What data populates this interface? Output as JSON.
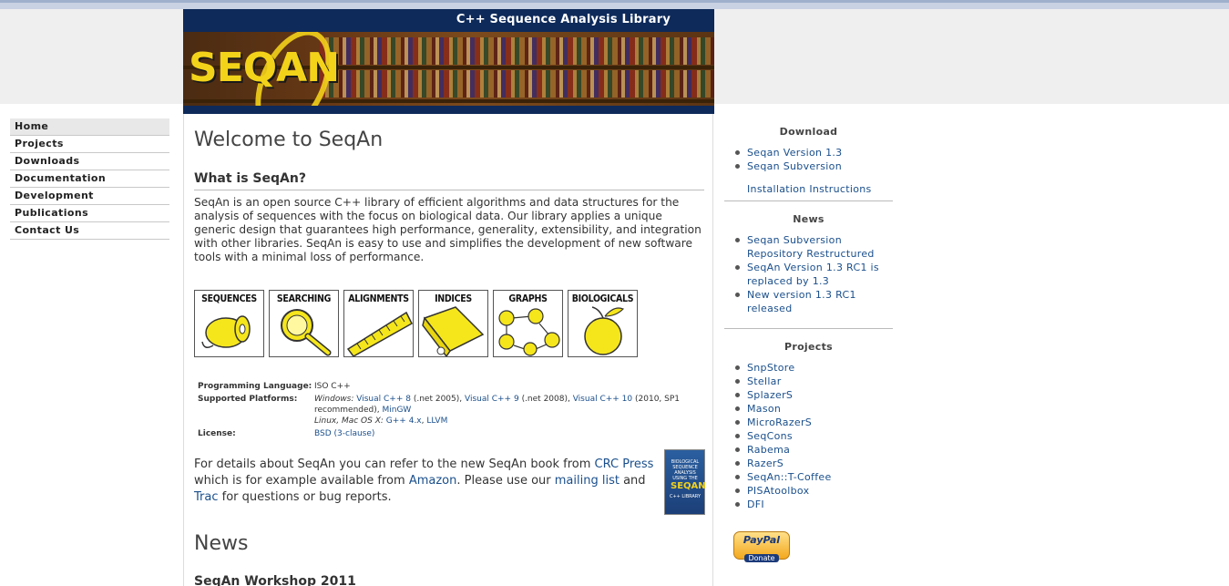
{
  "banner": {
    "subtitle": "C++ Sequence Analysis Library",
    "logo_text": "SEQAN"
  },
  "nav": {
    "items": [
      {
        "label": "Home"
      },
      {
        "label": "Projects"
      },
      {
        "label": "Downloads"
      },
      {
        "label": "Documentation"
      },
      {
        "label": "Development"
      },
      {
        "label": "Publications"
      },
      {
        "label": "Contact Us"
      }
    ]
  },
  "main": {
    "title": "Welcome to SeqAn",
    "what_heading": "What is SeqAn?",
    "intro": "SeqAn is an open source C++ library of efficient algorithms and data structures for the analysis of sequences with the focus on biological data. Our library applies a unique generic design that guarantees high performance, generality, extensibility, and integration with other libraries. SeqAn is easy to use and simplifies the development of new software tools with a minimal loss of performance.",
    "features": [
      {
        "label": "SEQUENCES",
        "icon": "spool-icon"
      },
      {
        "label": "SEARCHING",
        "icon": "magnifier-icon"
      },
      {
        "label": "ALIGNMENTS",
        "icon": "ruler-icon"
      },
      {
        "label": "INDICES",
        "icon": "book-index-icon"
      },
      {
        "label": "GRAPHS",
        "icon": "graph-icon"
      },
      {
        "label": "BIOLOGICALS",
        "icon": "apple-icon"
      }
    ],
    "info": {
      "lang_key": "Programming Language:",
      "lang_val": "ISO C++",
      "platforms_key": "Supported Platforms:",
      "windows_label": "Windows:",
      "vc8": "Visual C++ 8",
      "vc8_note": "(.net 2005),",
      "vc9": "Visual C++ 9",
      "vc9_note": "(.net 2008),",
      "vc10": "Visual C++ 10",
      "vc10_note": "(2010, SP1 recommended),",
      "mingw": "MinGW",
      "unix_label": "Linux, Mac OS X:",
      "gcc": "G++ 4.x",
      "llvm": "LLVM",
      "license_key": "License:",
      "license_val": "BSD (3-clause)"
    },
    "details": {
      "t1": "For details about SeqAn you can refer to the new SeqAn book from ",
      "crc": "CRC Press",
      "t2": " which is for example available from ",
      "amazon": "Amazon",
      "t3": ". Please use our ",
      "mailing": "mailing list",
      "t4": " and ",
      "trac": "Trac",
      "t5": " for questions or bug reports."
    },
    "book_cover": {
      "title": "BIOLOGICAL SEQUENCE ANALYSIS USING THE",
      "logo": "SEQAN",
      "suffix": "C++ LIBRARY"
    },
    "news_heading": "News",
    "workshop_heading": "SeqAn Workshop 2011"
  },
  "sidebar": {
    "download_heading": "Download",
    "download_items": [
      {
        "label": "Seqan Version 1.3"
      },
      {
        "label": "Seqan Subversion"
      }
    ],
    "install_link": "Installation Instructions",
    "news_heading": "News",
    "news_items": [
      {
        "label": "Seqan Subversion Repository Restructured"
      },
      {
        "label": "SeqAn Version 1.3 RC1 is replaced by 1.3"
      },
      {
        "label": "New version 1.3 RC1 released"
      }
    ],
    "projects_heading": "Projects",
    "project_items": [
      {
        "label": "SnpStore"
      },
      {
        "label": "Stellar"
      },
      {
        "label": "SplazerS"
      },
      {
        "label": "Mason"
      },
      {
        "label": "MicroRazerS"
      },
      {
        "label": "SeqCons"
      },
      {
        "label": "Rabema"
      },
      {
        "label": "RazerS"
      },
      {
        "label": "SeqAn::T-Coffee"
      },
      {
        "label": "PISAtoolbox"
      },
      {
        "label": "DFI"
      }
    ],
    "paypal": {
      "brand": "PayPal",
      "donate": "Donate"
    }
  }
}
